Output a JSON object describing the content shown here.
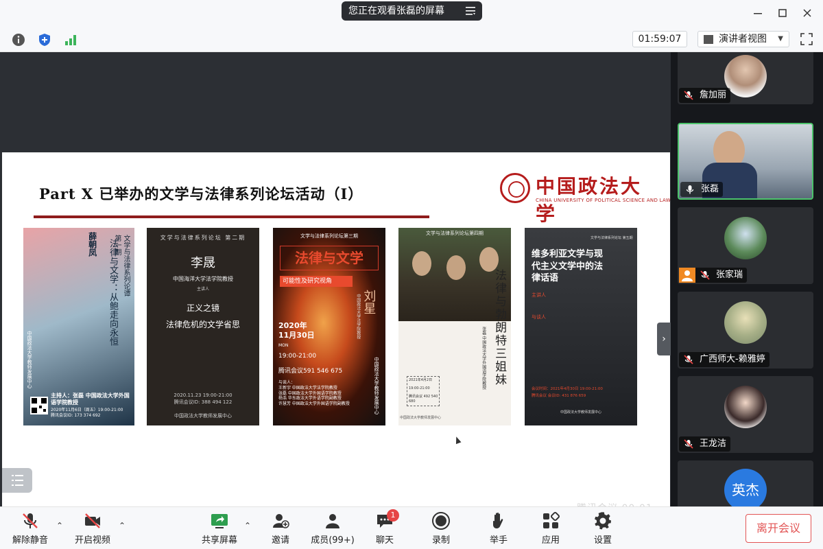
{
  "window": {
    "share_banner": "您正在观看张磊的屏幕",
    "timer": "01:59:07",
    "view_mode": "演讲者视图"
  },
  "slide": {
    "title": "Part X 已举办的文学与法律系列论坛活动（I）",
    "university_cn": "中国政法大学",
    "university_en": "CHINA UNIVERSITY OF POLITICAL SCIENCE AND LAW",
    "watermark": "腾讯会议 00:01",
    "posters": [
      {
        "title": "法律与文学：从鲍走向永恒",
        "speaker": "薛朝凤",
        "header": "文学与法律系列论谭第一期",
        "host": "主持人：张磊 中国政法大学外国语学院教授",
        "date": "2020年11月6日（周五）19:00-21:00",
        "meeting": "腾讯会议ID: 173 374 692",
        "publisher": "中国政法大学教师发展中心"
      },
      {
        "header": "文学与法律系列论坛 第二期",
        "speaker": "李晟",
        "affiliation": "中国海洋大学法学院教授",
        "role": "主讲人",
        "title1": "正义之镜",
        "title2": "法律危机的文学省思",
        "date": "2020.11.23 19:00-21:00",
        "meeting": "腾讯会议ID: 388 494 122",
        "publisher": "中国政法大学教师发展中心"
      },
      {
        "header": "文学与法律系列论坛第三期",
        "title": "法律与文学",
        "subtitle": "可能性及研究视角",
        "speaker": "刘星",
        "affiliation": "中国政法大学法学院教授",
        "date": "2020年 11月30日",
        "weekday": "MON",
        "time": "19:00-21:00",
        "meeting": "腾讯会议591 546 675",
        "discussants": [
          "与谈人：",
          "王新宇 中国政法大学法学院教授",
          "张磊 中国政法大学外国语学院教授",
          "杨浩 华东政法大学外语学院副教授",
          "许慧芳 中国政法大学外国语学院副教授"
        ],
        "publisher": "中国政法大学教师发展中心"
      },
      {
        "header": "文学与法律系列论坛第四期",
        "title": "法律与勃朗特三姐妹",
        "speaker": "张磊 中国政法大学外国语学院教授",
        "date": "2021年4月2日",
        "time": "19:00-21:00",
        "meeting": "腾讯会议 492 540 680",
        "publisher": "中国政法大学教师发展中心"
      },
      {
        "header": "文学与法律系列论坛 第五期",
        "title": "维多利亚文学与现代主义文学中的法律话语",
        "speaker_label": "主讲人",
        "discussant_label": "与谈人",
        "date": "会议时间：2021年4月30日 19:00-21:00",
        "meeting": "腾讯会议 会议ID: 431 876 659",
        "publisher": "中国政法大学教师发展中心"
      }
    ]
  },
  "participants": [
    {
      "name": "詹加丽",
      "muted": true
    },
    {
      "name": "张磊",
      "muted": false,
      "active": true
    },
    {
      "name": "张家瑞",
      "muted": true,
      "has_avatar_icon": true
    },
    {
      "name": "广西师大-赖雅婷",
      "muted": true
    },
    {
      "name": "王龙洁",
      "muted": true
    },
    {
      "name": "英杰",
      "muted": true
    }
  ],
  "toolbar": {
    "unmute": "解除静音",
    "start_video": "开启视频",
    "share_screen": "共享屏幕",
    "invite": "邀请",
    "members": "成员(99+)",
    "chat": "聊天",
    "chat_badge": "1",
    "record": "录制",
    "raise_hand": "举手",
    "apps": "应用",
    "settings": "设置",
    "leave": "离开会议"
  },
  "colors": {
    "accent_red": "#b51c1c",
    "leave_red": "#e25454",
    "active_green": "#4cc36b"
  }
}
